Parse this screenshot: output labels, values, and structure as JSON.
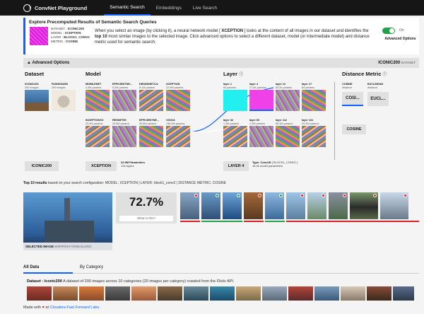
{
  "app": {
    "title": "ConvNet Playground"
  },
  "nav": {
    "tabs": [
      {
        "label": "Semantic Search"
      },
      {
        "label": "Embeddings"
      },
      {
        "label": "Live Search"
      }
    ]
  },
  "intro": {
    "title": "Explore Precomputed Results of Semantic Search Queries",
    "meta": {
      "dataset_key": "DATASET :",
      "dataset": "ICONIC200",
      "model_key": "MODEL :",
      "model": "XCEPTION",
      "layer_key": "LAYER :",
      "layer": "BLOCK1_CONV2",
      "metric_key": "METRIC :",
      "metric": "COSINE"
    },
    "text_1": "When you select an image (by clicking it), a neural network model [ ",
    "text_model": "XCEPTION",
    "text_2": " ] looks at the content of all images in our dataset and identifies the ",
    "text_bold": "top 10",
    "text_3": " most similar images to the selected image. Click advanced options to select a different dataset, model (or intermediate model) and distance metric used for semantic search.",
    "toggle_state": "On",
    "toggle_label": "Advanced Options"
  },
  "advanced": {
    "bar_label": "▲ Advanced Options",
    "dataset_name": "ICONIC200",
    "dataset_suffix": "DATASET",
    "dataset_section": "Dataset",
    "model_section": "Model",
    "layer_section": "Layer",
    "distance_section": "Distance Metric",
    "datasets": [
      {
        "label": "ICONIC200",
        "sub": "200 images"
      },
      {
        "label": "FASHION200",
        "sub": "200 images"
      }
    ],
    "models": [
      {
        "label": "MOBILENET",
        "sub": "4.3M params"
      },
      {
        "label": "EFFICIENTNE...",
        "sub": "5.3M params"
      },
      {
        "label": "DENSENET121",
        "sub": "8.1M params"
      },
      {
        "label": "XCEPTION",
        "sub": "22.9M params"
      },
      {
        "label": "INCEPTIONV3",
        "sub": "23.9M params"
      },
      {
        "label": "RESNET50",
        "sub": "25.6M params"
      },
      {
        "label": "EFFICIENTNE...",
        "sub": "30.6M params"
      },
      {
        "label": "VGG16",
        "sub": "138.4M params"
      }
    ],
    "layers": [
      {
        "label": "layer 1",
        "sub": "64 params"
      },
      {
        "label": "layer 4",
        "sub": "17.4K params"
      },
      {
        "label": "layer 12",
        "sub": "53.2k params"
      },
      {
        "label": "layer 17",
        "sub": "69 params"
      },
      {
        "label": "layer 32",
        "sub": "1.3M params"
      },
      {
        "label": "layer 60",
        "sub": "2.4M params"
      },
      {
        "label": "layer 112",
        "sub": "58.1M params"
      },
      {
        "label": "layer 131",
        "sub": "20.9M params"
      }
    ],
    "metrics": [
      {
        "label": "COSINE",
        "sub": "distance",
        "short": "COSI..."
      },
      {
        "label": "EUCLIDEAN",
        "sub": "distance",
        "short": "EUCL..."
      }
    ],
    "dataset_chip": "ICONIC200",
    "model_chip": "XCEPTION",
    "model_info_params": "22.9M Parameters",
    "model_info_layers": "134 layers",
    "layer_chip": "LAYER 4",
    "layer_info_type": "Type: Conv2D",
    "layer_info_name": "[ BLOCK1_CONV2 ]",
    "layer_info_params": "18.4k model parameters",
    "metric_chip": "COSINE"
  },
  "top10": {
    "heading_bold": "Top 10 results",
    "heading_text": " based on your search configuration: ",
    "model_key": "MODEL:",
    "model_value": "XCEPTION",
    "layer_key": "LAYER:",
    "layer_value": "block1_conv2",
    "metric_key": "DISTANCE METRIC:",
    "metric_value": "COSINE",
    "selected_label": "SELECTED IMAGE",
    "selected_name": "EMPIRESTATEBUILDING",
    "score": "72.7%",
    "score_link": "What is this?",
    "colors": {
      "match": "#24a148",
      "mismatch": "#da1e28"
    }
  },
  "bottom": {
    "tabs": [
      {
        "label": "All Data"
      },
      {
        "label": "By Category"
      }
    ],
    "dataset_key": "Dataset : ",
    "dataset_name": "Iconic200",
    "dataset_desc": " A dataset of 200 images across 10 categories (20 images per category) crawled from the Flickr API."
  },
  "footer": {
    "prefix": "Made with ",
    "heart": "♥",
    "middle": " at ",
    "link": "Cloudera Fast Forward Labs."
  }
}
